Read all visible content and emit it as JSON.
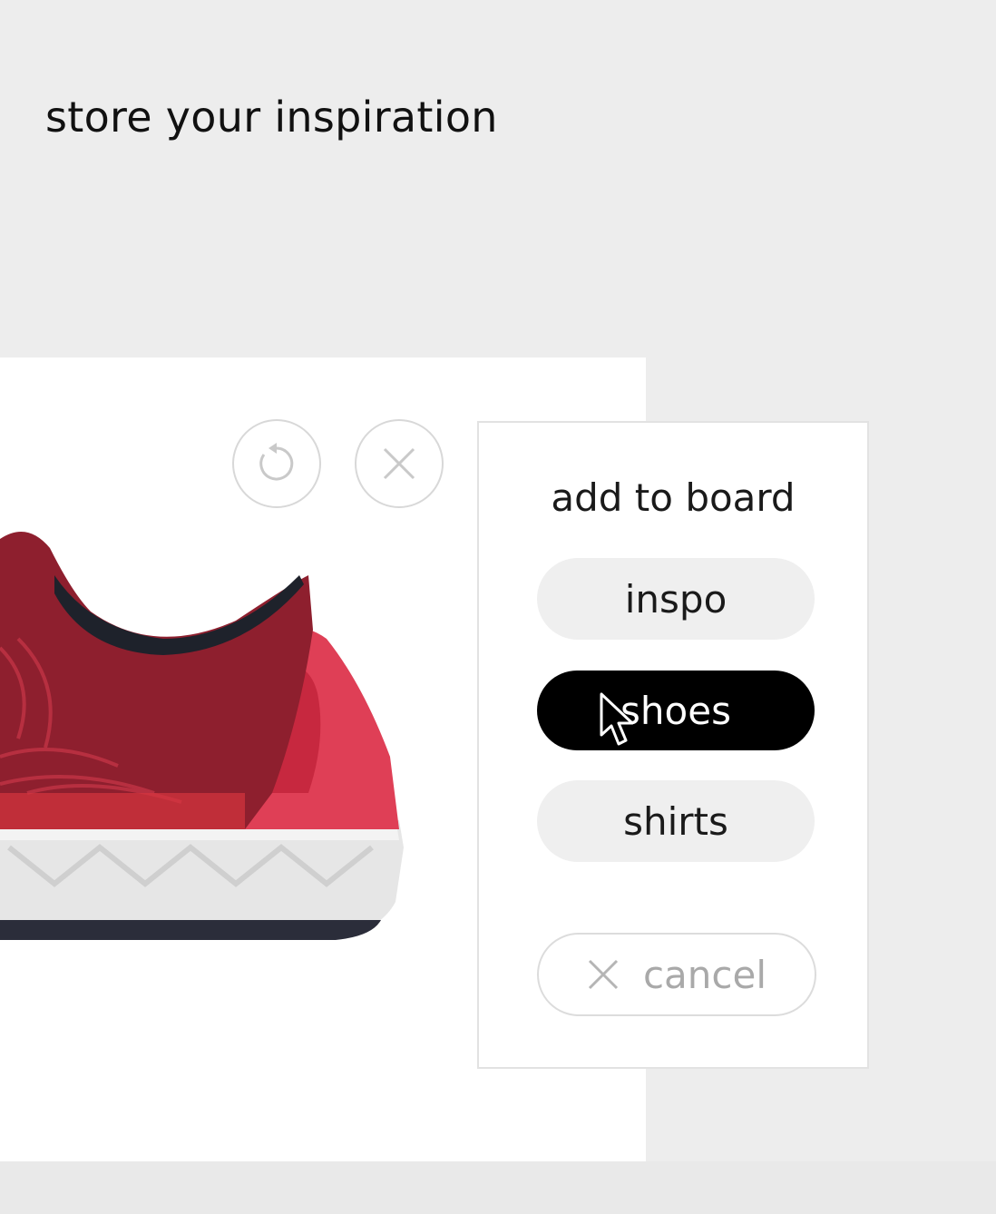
{
  "page": {
    "headline": "store your inspiration"
  },
  "image_card": {
    "image_subject": "red running shoe",
    "actions": [
      {
        "icon": "refresh-icon"
      },
      {
        "icon": "close-icon"
      }
    ]
  },
  "board_panel": {
    "title": "add to board",
    "boards": [
      {
        "label": "inspo",
        "selected": false
      },
      {
        "label": "shoes",
        "selected": true
      },
      {
        "label": "shirts",
        "selected": false
      }
    ],
    "cancel_label": "cancel",
    "cancel_icon": "close-icon"
  },
  "colors": {
    "background": "#ededed",
    "card": "#ffffff",
    "selected_bg": "#000000",
    "selected_text": "#ffffff",
    "option_bg": "#efefef",
    "muted_text": "#a9a9a9",
    "shoe_upper": "#8e1f2e",
    "shoe_heel": "#df3f56"
  }
}
